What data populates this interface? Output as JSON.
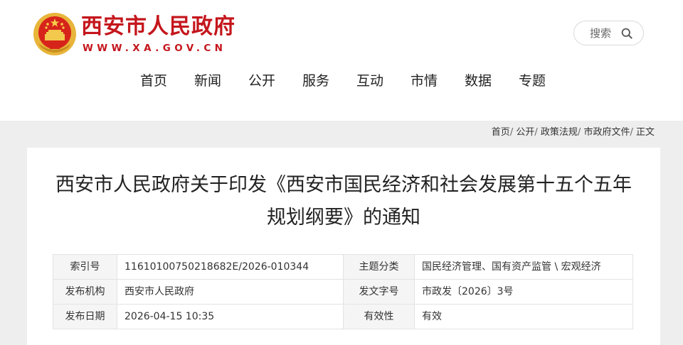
{
  "site": {
    "title": "西安市人民政府",
    "domain": "WWW.XA.GOV.CN"
  },
  "search": {
    "label": "搜索"
  },
  "nav": [
    "首页",
    "新闻",
    "公开",
    "服务",
    "互动",
    "市情",
    "数据",
    "专题"
  ],
  "breadcrumb": {
    "items": [
      "首页",
      "公开",
      "政策法规",
      "市政府文件",
      "正文"
    ],
    "separator": "/"
  },
  "document": {
    "title": "西安市人民政府关于印发《西安市国民经济和社会发展第十五个五年规划纲要》的通知"
  },
  "meta": [
    {
      "label": "索引号",
      "value": "11610100750218682E/2026-010344",
      "label2": "主题分类",
      "value2": "国民经济管理、国有资产监管 \\ 宏观经济"
    },
    {
      "label": "发布机构",
      "value": "西安市人民政府",
      "label2": "发文字号",
      "value2": "市政发〔2026〕3号"
    },
    {
      "label": "发布日期",
      "value": "2026-04-15 10:35",
      "label2": "有效性",
      "value2": "有效"
    }
  ],
  "colors": {
    "brand": "#c4161c",
    "emblem_gold": "#e8b53a",
    "page_bg": "#eeeeee"
  }
}
